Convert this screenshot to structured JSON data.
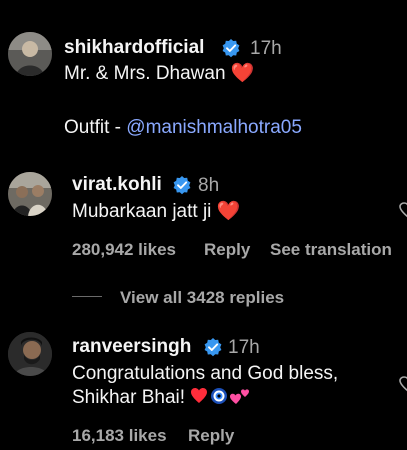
{
  "comments": [
    {
      "username": "shikhardofficial",
      "time": "17h",
      "line1_text": "Mr. & Mrs. Dhawan",
      "line1_emoji": "❤️",
      "line2_prefix": "Outfit - ",
      "line2_mention": "@manishmalhotra05"
    },
    {
      "username": "virat.kohli",
      "time": "8h",
      "text": "Mubarkaan jatt ji",
      "emoji": "❤️",
      "likes": "280,942 likes",
      "reply": "Reply",
      "translation": "See translation",
      "view_replies": "View all 3428 replies"
    },
    {
      "username": "ranveersingh",
      "time": "17h",
      "line1": "Congratulations and God bless,",
      "line2": "Shikhar Bhai!",
      "likes": "16,183 likes",
      "reply": "Reply"
    }
  ],
  "icons": {
    "verified": "verified-badge-icon",
    "like": "heart-outline-icon"
  },
  "colors": {
    "background": "#000000",
    "mention": "#8aa9ff",
    "verified": "#3897f0",
    "heart": "#ff2d3b",
    "muted": "#a8a8a8"
  }
}
